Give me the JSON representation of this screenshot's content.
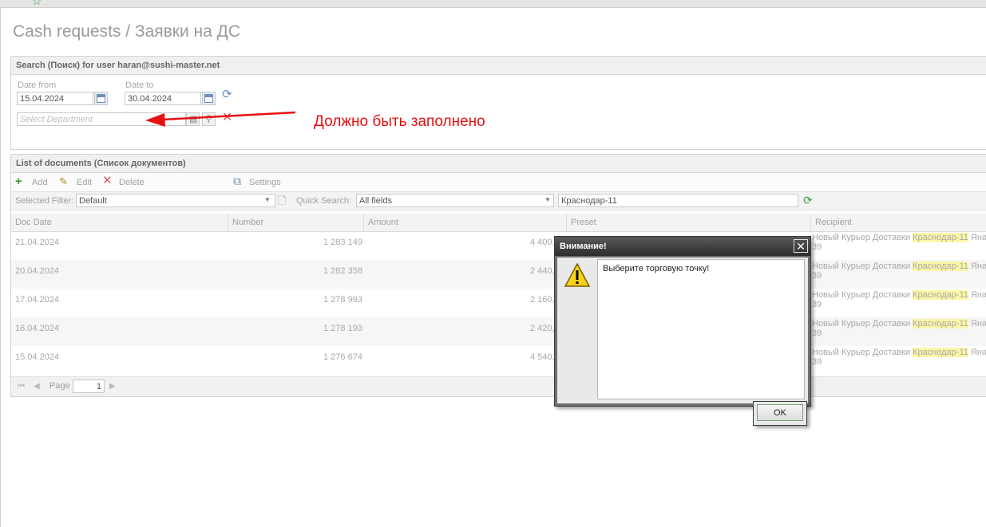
{
  "page": {
    "title": "Cash requests / Заявки на ДС"
  },
  "search": {
    "header": "Search (Поиск) for user haran@sushi-master.net",
    "date_from_label": "Date from",
    "date_from_value": "15.04.2024",
    "date_to_label": "Date to",
    "date_to_value": "30.04.2024",
    "department_placeholder": "Select Department"
  },
  "annotation": {
    "text": "Должно быть заполнено",
    "color": "#e81010"
  },
  "list": {
    "header": "List of documents (Список документов)",
    "toolbar": {
      "add": "Add",
      "edit": "Edit",
      "delete": "Delete",
      "settings": "Settings"
    },
    "filter": {
      "selected_filter_label": "Selected Filter:",
      "selected_filter_value": "Default",
      "quick_search_label": "Quick Search:",
      "quick_search_scope": "All fields",
      "quick_search_value": "Краснодар-11"
    },
    "columns": [
      "Doc Date",
      "Number",
      "Amount",
      "Preset",
      "Recipient"
    ],
    "rows": [
      {
        "date": "21.04.2024",
        "number": "1 283 149",
        "amount": "4 400,",
        "recipient_pre": "Новый Курьер Доставки ",
        "recipient_hl": "Краснодар-11",
        "recipient_post": " Яна",
        "recipient_line2": "39"
      },
      {
        "date": "20.04.2024",
        "number": "1 282 358",
        "amount": "2 440,",
        "recipient_pre": "Новый Курьер Доставки ",
        "recipient_hl": "Краснодар-11",
        "recipient_post": " Яна",
        "recipient_line2": "39"
      },
      {
        "date": "17.04.2024",
        "number": "1 278 993",
        "amount": "2 160,",
        "recipient_pre": "Новый Курьер Доставки ",
        "recipient_hl": "Краснодар-11",
        "recipient_post": " Яна",
        "recipient_line2": "39"
      },
      {
        "date": "16.04.2024",
        "number": "1 278 193",
        "amount": "2 420,",
        "recipient_pre": "Новый Курьер Доставки ",
        "recipient_hl": "Краснодар-11",
        "recipient_post": " Яна",
        "recipient_line2": "39"
      },
      {
        "date": "15.04.2024",
        "number": "1 276 674",
        "amount": "4 540,",
        "recipient_pre": "Новый Курьер Доставки ",
        "recipient_hl": "Краснодар-11",
        "recipient_post": " Яна",
        "recipient_line2": "39"
      }
    ],
    "pager": {
      "label": "Page",
      "value": "1"
    }
  },
  "dialog": {
    "title": "Внимание!",
    "message": "Выберите торговую точку!",
    "ok_label": "OK",
    "close_glyph": "✕"
  },
  "colors": {
    "highlight": "#fbf6a6",
    "annotation_red": "#e81010"
  }
}
